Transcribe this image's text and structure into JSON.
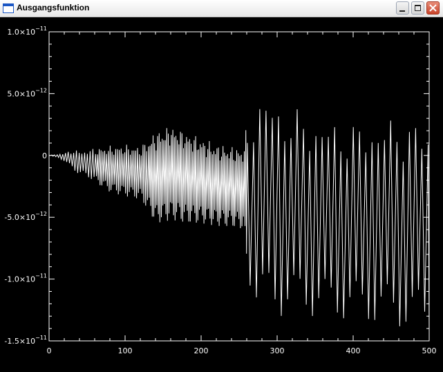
{
  "window": {
    "title": "Ausgangsfunktion",
    "buttons": [
      "minimize",
      "maximize",
      "close"
    ],
    "icons": {
      "app": "window-icon",
      "minimize": "minimize-icon",
      "maximize": "maximize-icon",
      "close": "close-icon"
    }
  },
  "colors": {
    "background": "#000000",
    "plot": "#ffffff"
  },
  "chart_data": {
    "type": "line",
    "title": "",
    "xlabel": "",
    "ylabel": "",
    "xlim": [
      0,
      500
    ],
    "ylim": [
      -1.5e-11,
      1e-11
    ],
    "grid": false,
    "xticks": [
      {
        "value": 0,
        "label": "0"
      },
      {
        "value": 100,
        "label": "100"
      },
      {
        "value": 200,
        "label": "200"
      },
      {
        "value": 300,
        "label": "300"
      },
      {
        "value": 400,
        "label": "400"
      },
      {
        "value": 500,
        "label": "500"
      }
    ],
    "yticks": [
      {
        "value": 1e-11,
        "mantissa": "1.0×10",
        "exponent": "−11"
      },
      {
        "value": 5e-12,
        "mantissa": "5.0×10",
        "exponent": "−12"
      },
      {
        "value": 0,
        "mantissa": "0",
        "exponent": ""
      },
      {
        "value": -5e-12,
        "mantissa": "-5.0×10",
        "exponent": "−12"
      },
      {
        "value": -1e-11,
        "mantissa": "-1.0×10",
        "exponent": "−11"
      },
      {
        "value": -1.5e-11,
        "mantissa": "-1.5×10",
        "exponent": "−11"
      }
    ],
    "series": [
      {
        "envelope": {
          "x": [
            0,
            10,
            20,
            30,
            40,
            50,
            60,
            80,
            100,
            120,
            140,
            160,
            180,
            200,
            220,
            240,
            255,
            262,
            270,
            280,
            300,
            320,
            340,
            360,
            380,
            400,
            420,
            440,
            460,
            480,
            500
          ],
          "upper": [
            0.0,
            1e-13,
            2e-13,
            5e-13,
            4e-13,
            5e-13,
            6e-13,
            8e-13,
            9e-13,
            8e-13,
            2e-12,
            2.5e-12,
            2e-12,
            1.5e-12,
            1e-12,
            8e-13,
            7e-13,
            3.2e-12,
            4.5e-12,
            5.5e-12,
            4.5e-12,
            4e-12,
            3.5e-12,
            3.2e-12,
            3e-12,
            2.8e-12,
            3e-12,
            3.2e-12,
            3.3e-12,
            3e-12,
            2.8e-12
          ],
          "lower": [
            0.0,
            -2e-13,
            -5e-13,
            -1.2e-12,
            -1.6e-12,
            -1.8e-12,
            -2.2e-12,
            -3e-12,
            -3.3e-12,
            -3.6e-12,
            -5.5e-12,
            -5.2e-12,
            -5.5e-12,
            -5.5e-12,
            -5.7e-12,
            -5.8e-12,
            -6e-12,
            -1.15e-11,
            -1.25e-11,
            -1.28e-11,
            -1.3e-11,
            -1.28e-11,
            -1.3e-11,
            -1.32e-11,
            -1.33e-11,
            -1.34e-11,
            -1.36e-11,
            -1.38e-11,
            -1.4e-11,
            -1.42e-11,
            -1.43e-11
          ]
        }
      }
    ]
  }
}
